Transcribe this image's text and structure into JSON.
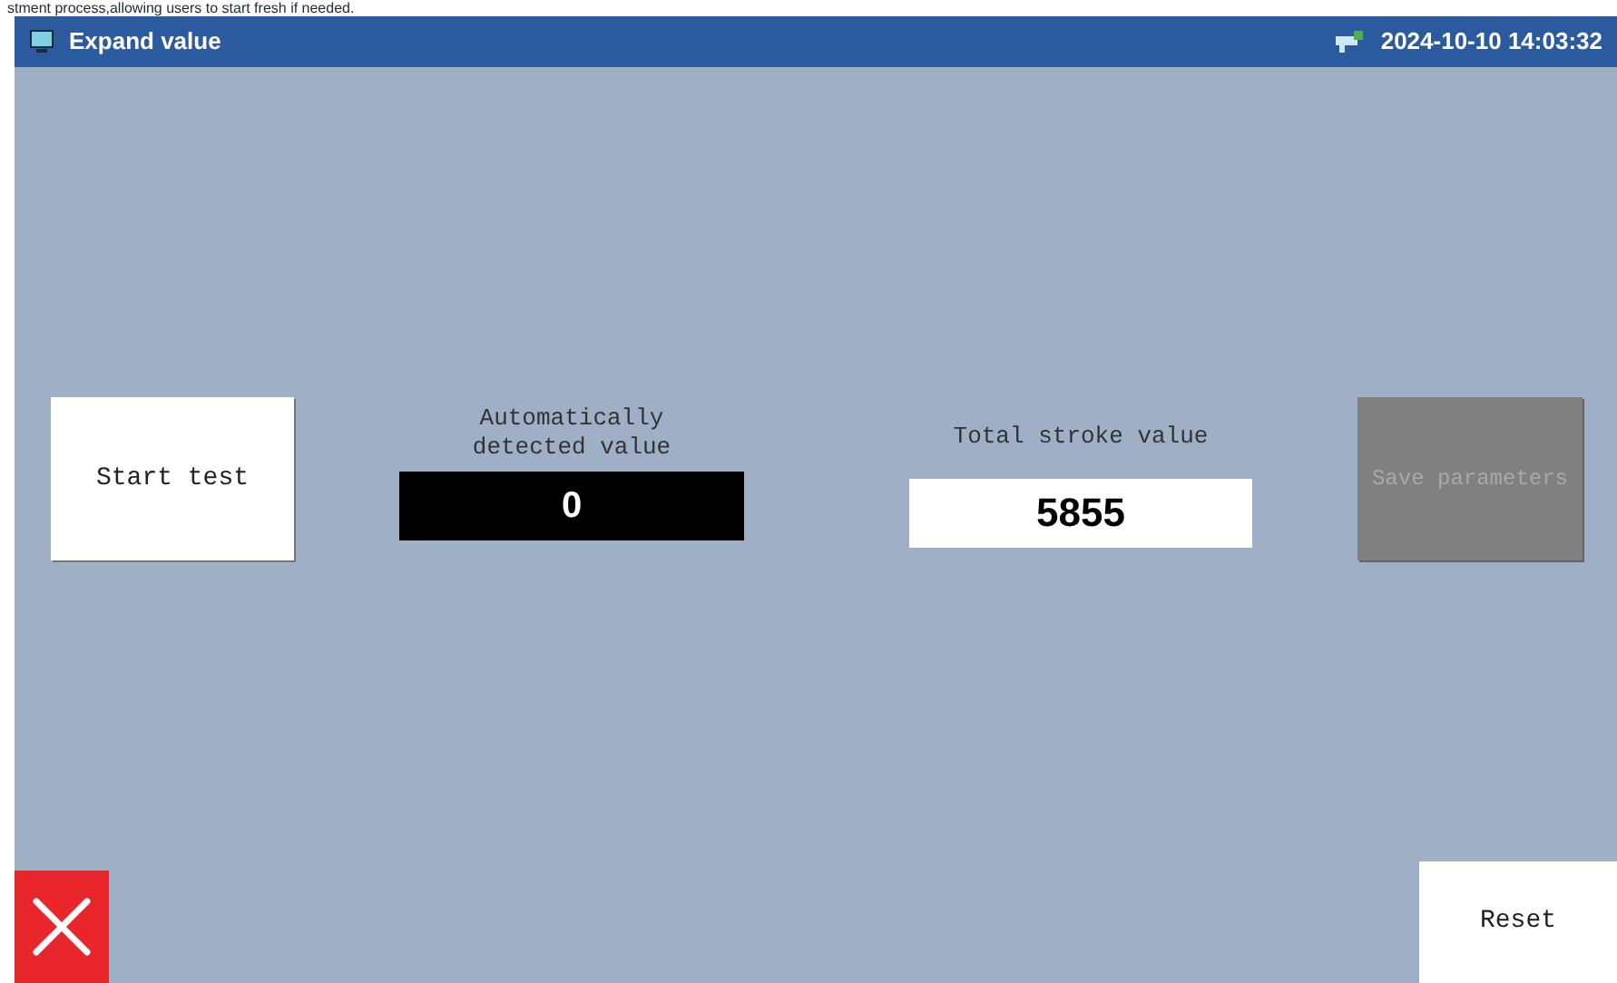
{
  "caption": "stment process,allowing users to start fresh if needed.",
  "window": {
    "title": "Expand value",
    "datetime": "2024-10-10 14:03:32"
  },
  "start_button": {
    "label": "Start test"
  },
  "detected": {
    "label": "Automatically detected value",
    "value": "0"
  },
  "total": {
    "label": "Total stroke value",
    "value": "5855"
  },
  "save_button": {
    "label": "Save parameters",
    "disabled": true
  },
  "reset_button": {
    "label": "Reset"
  }
}
